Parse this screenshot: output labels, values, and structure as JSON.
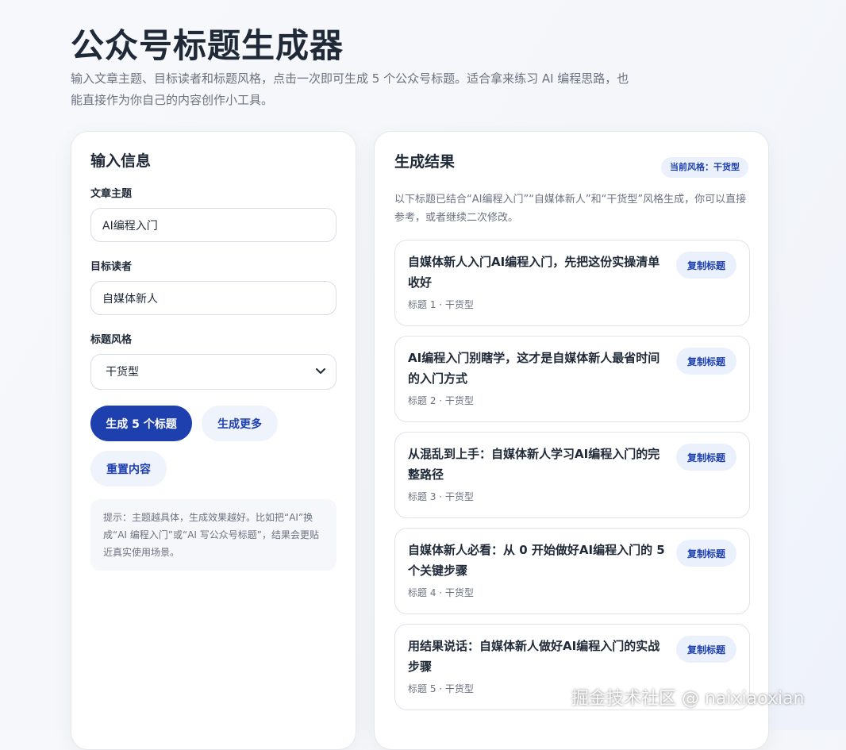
{
  "page": {
    "title": "公众号标题生成器",
    "description": "输入文章主题、目标读者和标题风格，点击一次即可生成 5 个公众号标题。适合拿来练习 AI 编程思路，也能直接作为你自己的内容创作小工具。"
  },
  "input_panel": {
    "heading": "输入信息",
    "topic": {
      "label": "文章主题",
      "value": "AI编程入门"
    },
    "audience": {
      "label": "目标读者",
      "value": "自媒体新人"
    },
    "style": {
      "label": "标题风格",
      "selected": "干货型"
    },
    "buttons": {
      "generate": "生成 5 个标题",
      "more": "生成更多",
      "reset": "重置内容"
    },
    "hint": "提示：主题越具体，生成效果越好。比如把“AI”换成“AI 编程入门”或“AI 写公众号标题”，结果会更贴近真实使用场景。"
  },
  "result_panel": {
    "heading": "生成结果",
    "badge": "当前风格：干货型",
    "description": "以下标题已结合“AI编程入门”“自媒体新人”和“干货型”风格生成，你可以直接参考，或者继续二次修改。",
    "copy_label": "复制标题",
    "titles": [
      {
        "text": "自媒体新人入门AI编程入门，先把这份实操清单收好",
        "meta": "标题 1 · 干货型"
      },
      {
        "text": "AI编程入门别瞎学，这才是自媒体新人最省时间的入门方式",
        "meta": "标题 2 · 干货型"
      },
      {
        "text": "从混乱到上手：自媒体新人学习AI编程入门的完整路径",
        "meta": "标题 3 · 干货型"
      },
      {
        "text": "自媒体新人必看：从 0 开始做好AI编程入门的 5 个关键步骤",
        "meta": "标题 4 · 干货型"
      },
      {
        "text": "用结果说话：自媒体新人做好AI编程入门的实战步骤",
        "meta": "标题 5 · 干货型"
      }
    ]
  },
  "watermark": "掘金技术社区 @ naixiaoxian"
}
